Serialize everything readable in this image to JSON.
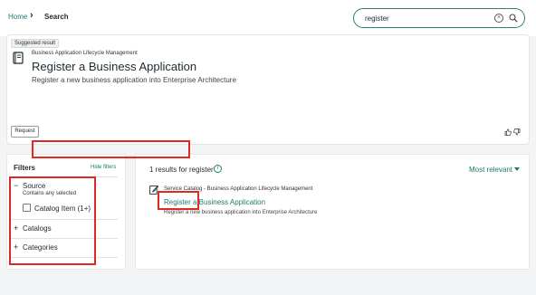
{
  "breadcrumb": {
    "home": "Home",
    "separator": "›",
    "current": "Search"
  },
  "search": {
    "value": "register",
    "clear_icon": "clear-circle-icon",
    "search_icon": "search-icon"
  },
  "suggested": {
    "badge": "Suggested result",
    "icon": "book-icon",
    "category": "Business Application Lifecycle Management",
    "title": "Register a Business Application",
    "description": "Register a new business application into Enterprise Architecture",
    "request_label": "Request",
    "thumbs_up_icon": "thumbs-up-icon",
    "thumbs_down_icon": "thumbs-down-icon"
  },
  "filters": {
    "title": "Filters",
    "hide_label": "Hide filters",
    "source": {
      "toggle": "−",
      "label": "Source",
      "subtext": "Contains any selected",
      "option_label": "Catalog Item (1+)"
    },
    "catalogs": {
      "toggle": "+",
      "label": "Catalogs"
    },
    "categories": {
      "toggle": "+",
      "label": "Categories"
    }
  },
  "results": {
    "count_text": "1 results for register",
    "info_icon": "info-icon",
    "sort_label": "Most relevant",
    "items": [
      {
        "icon": "edit-form-icon",
        "category": "Service Catalog - Business Application Lifecycle Management",
        "title": "Register a Business Application",
        "description": "Register a new business application into Enterprise Architecture"
      }
    ]
  },
  "colors": {
    "accent": "#1d7a6e",
    "annotation_red": "#e0291f",
    "background": "#f3f4f5"
  }
}
